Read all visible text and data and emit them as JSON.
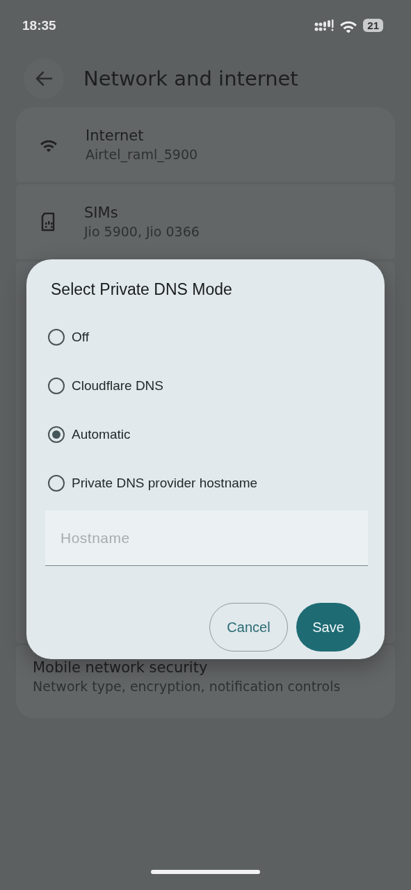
{
  "status_bar": {
    "time": "18:35",
    "battery": "21"
  },
  "header": {
    "title": "Network and internet"
  },
  "settings": [
    {
      "kind": "wifi",
      "title": "Internet",
      "subtitle": "Airtel_raml_5900"
    },
    {
      "kind": "sim",
      "title": "SIMs",
      "subtitle": "Jio 5900, Jio 0366"
    },
    {
      "kind": "hidden"
    },
    {
      "kind": "plain",
      "title": "Mobile network security",
      "subtitle": "Network type, encryption, notification controls"
    }
  ],
  "dialog": {
    "title": "Select Private DNS Mode",
    "options": [
      {
        "label": "Off",
        "selected": false
      },
      {
        "label": "Cloudflare DNS",
        "selected": false
      },
      {
        "label": "Automatic",
        "selected": true
      },
      {
        "label": "Private DNS provider hostname",
        "selected": false
      }
    ],
    "hostname": {
      "placeholder": "Hostname"
    },
    "buttons": [
      {
        "label": "Cancel",
        "kind": "outlined"
      },
      {
        "label": "Save",
        "kind": "filled"
      }
    ]
  }
}
